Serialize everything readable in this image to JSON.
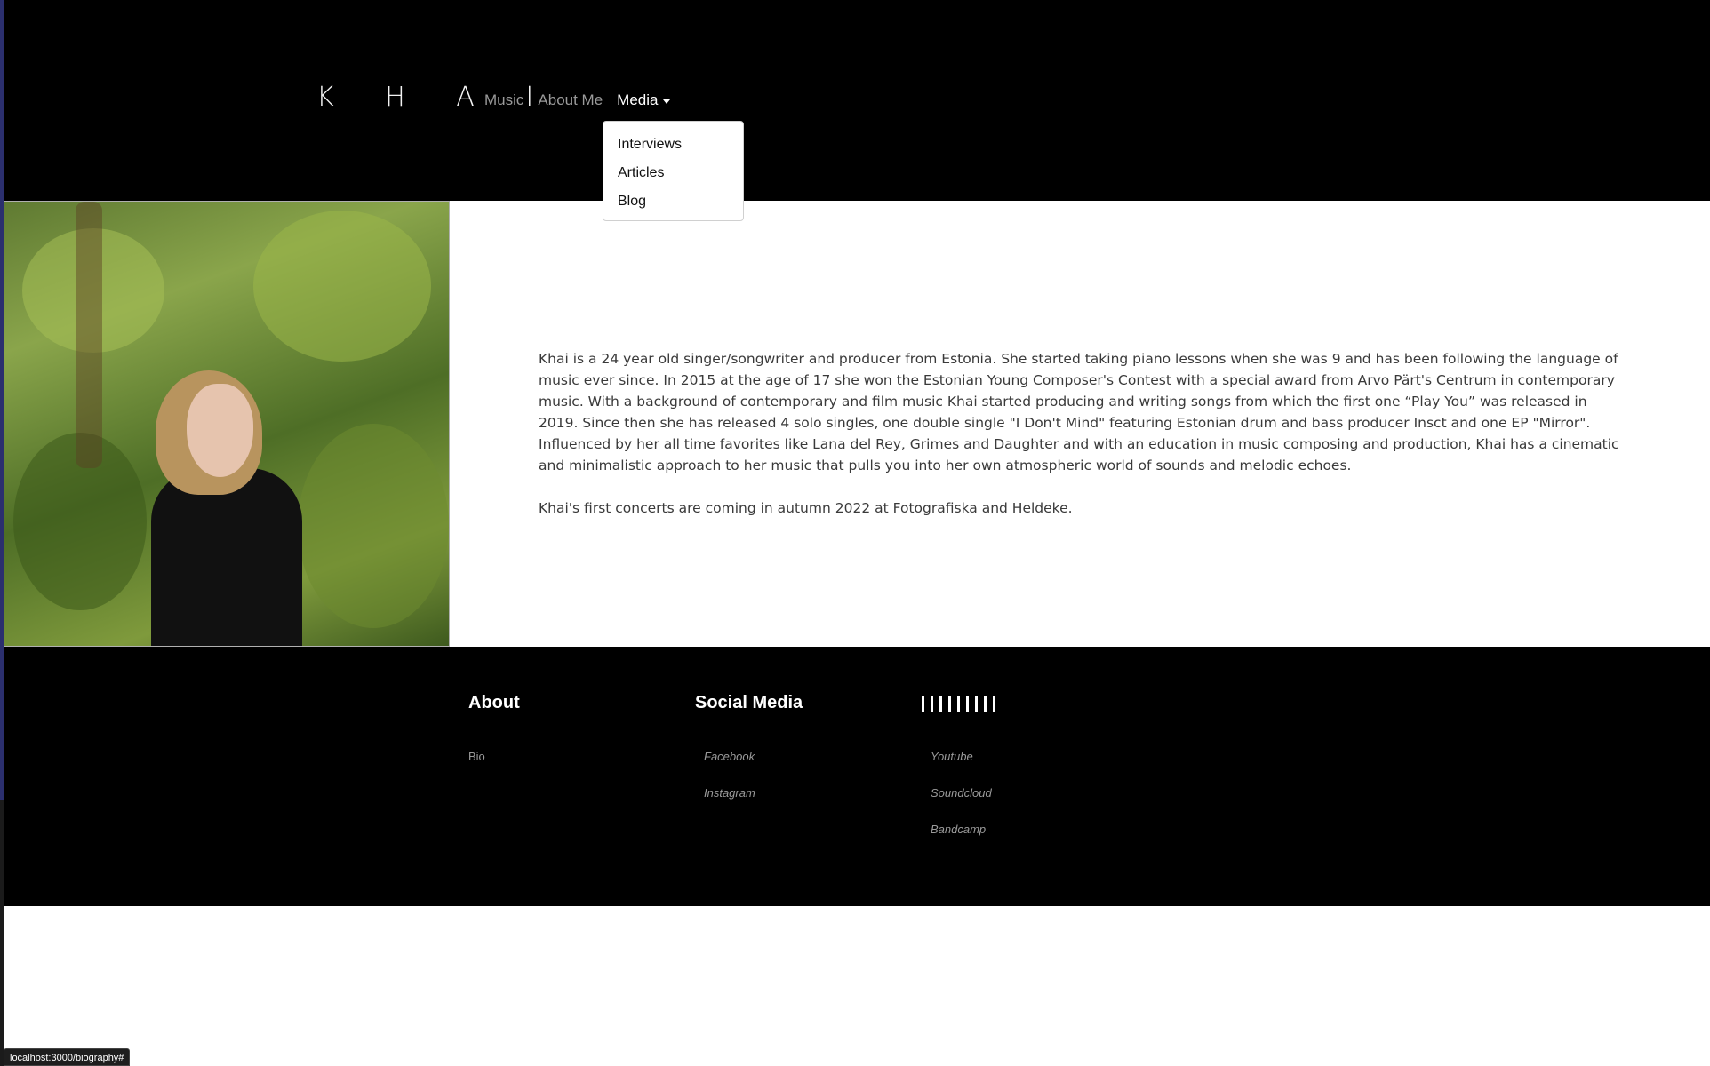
{
  "header": {
    "brand": "K H A I",
    "nav": {
      "music": "Music",
      "about": "About Me",
      "media": "Media"
    },
    "media_dropdown": [
      "Interviews",
      "Articles",
      "Blog"
    ]
  },
  "main": {
    "photo_alt": "portrait-photo",
    "bio_paragraphs": [
      "Khai is a 24 year old singer/songwriter and producer from Estonia. She started taking piano lessons when she was 9 and has been following the language of music ever since. In 2015 at the age of 17 she won the Estonian Young Composer's Contest with a special award from Arvo Pärt's Centrum in contemporary music. With a background of contemporary and film music Khai started producing and writing songs from which the first one “Play You” was released in 2019. Since then she has released 4 solo singles, one double single \"I Don't Mind\" featuring Estonian drum and bass producer Insct and one EP \"Mirror\". Influenced by her all time favorites like Lana del Rey, Grimes and Daughter and with an education in music composing and production, Khai has a cinematic and minimalistic approach to her music that pulls you into her own atmospheric world of sounds and melodic echoes.",
      "Khai's first concerts are coming in autumn 2022 at Fotografiska and Heldeke."
    ]
  },
  "footer": {
    "about": {
      "title": "About",
      "links": [
        "Bio"
      ]
    },
    "social": {
      "title": "Social Media",
      "links": [
        "Facebook",
        "Instagram"
      ]
    },
    "streaming": {
      "title_icon": "bars-icon",
      "links": [
        "Youtube",
        "Soundcloud",
        "Bandcamp"
      ]
    }
  },
  "status_bar": "localhost:3000/biography#",
  "colors": {
    "header_bg": "#000000",
    "nav_inactive": "#9a9a9a",
    "nav_active": "#ffffff",
    "body_text": "#3a3a3a",
    "footer_link": "#9a9a9a"
  }
}
